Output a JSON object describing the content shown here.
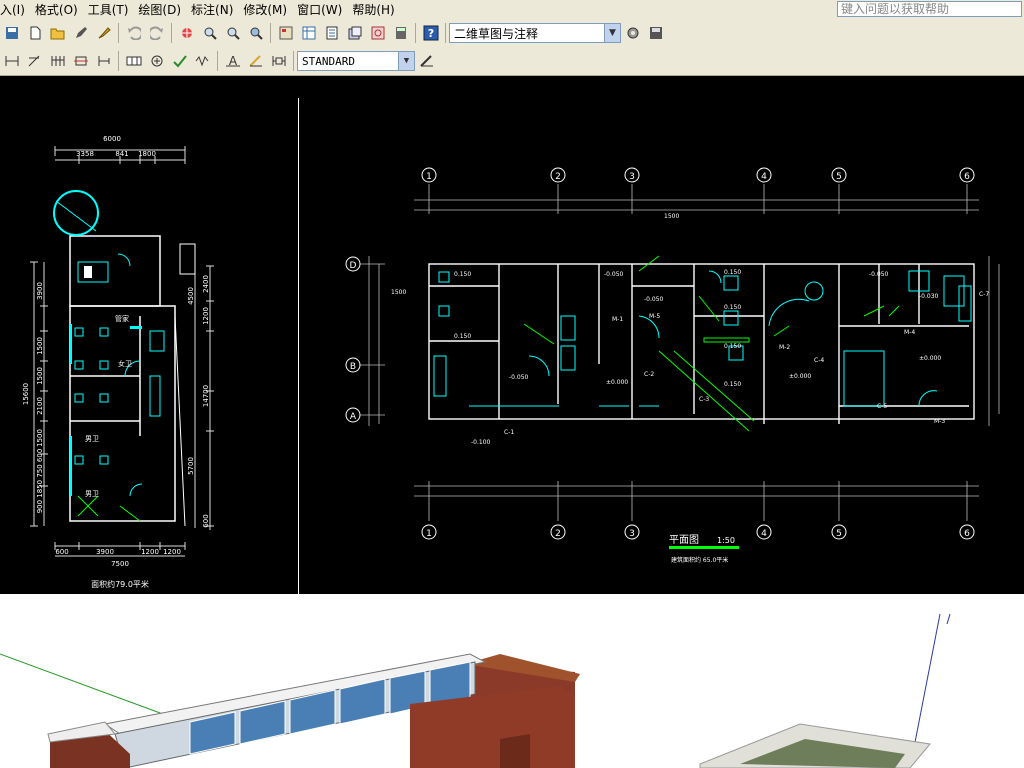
{
  "menubar": {
    "items": [
      "入(I)",
      "格式(O)",
      "工具(T)",
      "绘图(D)",
      "标注(N)",
      "修改(M)",
      "窗口(W)",
      "帮助(H)"
    ],
    "help_placeholder": "键入问题以获取帮助"
  },
  "toolbar": {
    "workspace": "二维草图与注释",
    "dim_style": "STANDARD"
  },
  "plan_small": {
    "top_dim": "6000",
    "sub_dims": [
      "3358",
      "841",
      "1800"
    ],
    "left_dim": "15600",
    "right_dims": [
      "2400",
      "1200",
      "4500",
      "14700",
      "5700",
      "600"
    ],
    "left_sub_dims": [
      "3900",
      "1500",
      "1500",
      "2100",
      "1500",
      "900 1850 750 600"
    ],
    "bottom_dims": [
      "600",
      "3900",
      "1200",
      "1200"
    ],
    "bottom_total": "7500",
    "rooms": [
      "管家",
      "女卫",
      "男卫",
      "男卫"
    ],
    "caption": "面积约79.0平米"
  },
  "plan_main": {
    "axes_top": [
      "1",
      "2",
      "3",
      "4",
      "5",
      "6"
    ],
    "axes_left": [
      "D",
      "B",
      "A"
    ],
    "title": "平面图",
    "scale": "1:50",
    "subtitle": "建筑面积约 65.0平米",
    "labels": [
      "0.150",
      "-0.050",
      "-0.050",
      "0.150",
      "0.150",
      "-0.050",
      "-0.030",
      "0.150",
      "±0.000",
      "±0.000",
      "±0.000",
      "-0.050",
      "0.150",
      "0.150",
      "-0.100",
      "M-1",
      "M-2",
      "M-3",
      "M-4",
      "M-5",
      "C-1",
      "C-2",
      "C-3",
      "C-4",
      "C-5",
      "C-7",
      "1500",
      "1500"
    ]
  }
}
